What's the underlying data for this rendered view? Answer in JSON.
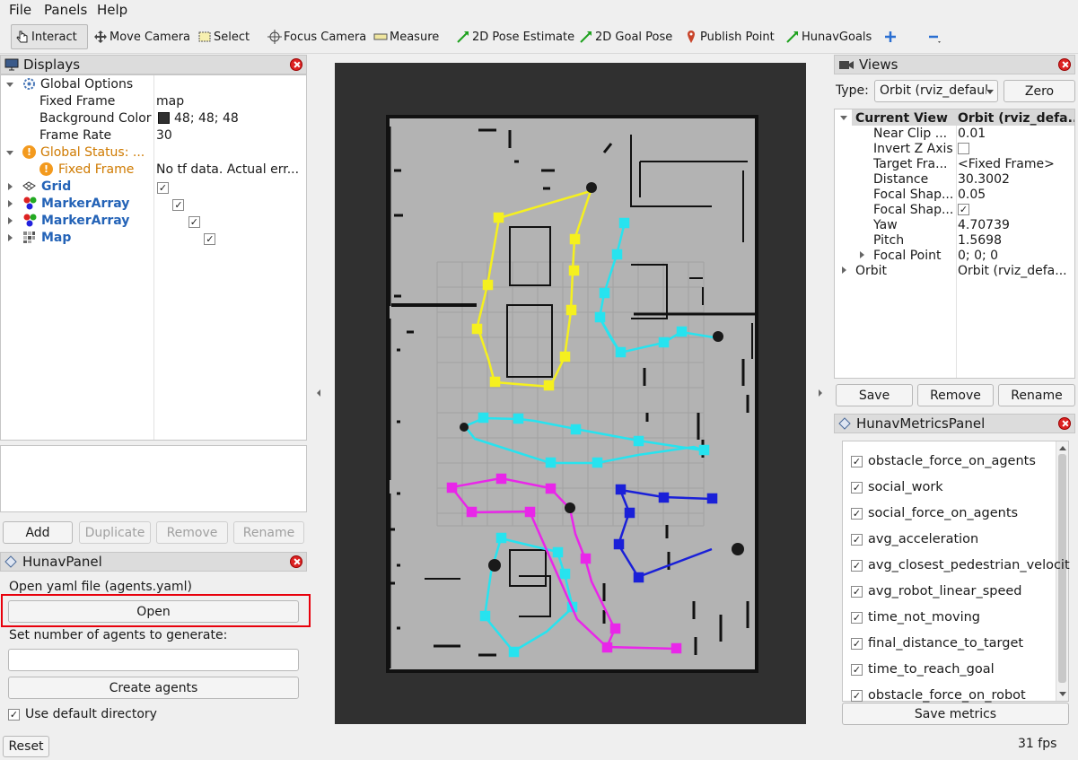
{
  "menu": {
    "file": "File",
    "panels": "Panels",
    "help": "Help"
  },
  "toolbar": {
    "interact": "Interact",
    "move_camera": "Move Camera",
    "select": "Select",
    "focus_camera": "Focus Camera",
    "measure": "Measure",
    "pose_estimate": "2D Pose Estimate",
    "goal_pose": "2D Goal Pose",
    "publish_point": "Publish Point",
    "hunav_goals": "HunavGoals",
    "add_icon": "plus-icon",
    "remove_icon": "minus-icon"
  },
  "displays": {
    "title": "Displays",
    "global_options": "Global Options",
    "fixed_frame_label": "Fixed Frame",
    "fixed_frame_value": "map",
    "bg_color_label": "Background Color",
    "bg_color_value": "48; 48; 48",
    "bg_color_swatch": "#303030",
    "frame_rate_label": "Frame Rate",
    "frame_rate_value": "30",
    "global_status": "Global Status: ...",
    "status_fixed_frame": "Fixed Frame",
    "status_message": "No tf data.  Actual err...",
    "items": [
      {
        "label": "Grid",
        "checked": true
      },
      {
        "label": "MarkerArray",
        "checked": true
      },
      {
        "label": "MarkerArray",
        "checked": true
      },
      {
        "label": "Map",
        "checked": true
      }
    ],
    "buttons": {
      "add": "Add",
      "duplicate": "Duplicate",
      "remove": "Remove",
      "rename": "Rename"
    }
  },
  "hunav_panel": {
    "title": "HunavPanel",
    "open_label": "Open yaml file (agents.yaml)",
    "open_button": "Open",
    "agents_label": "Set number of agents to generate:",
    "agents_value": "",
    "create_button": "Create agents",
    "default_dir_label": "Use default directory",
    "default_dir_checked": true
  },
  "reset_button": "Reset",
  "fps": "31 fps",
  "views": {
    "title": "Views",
    "type_label": "Type:",
    "type_value": "Orbit (rviz_defaul",
    "zero_button": "Zero",
    "header_name": "Current View",
    "header_value": "Orbit (rviz_defa...",
    "props": [
      {
        "label": "Near Clip ...",
        "value": "0.01"
      },
      {
        "label": "Invert Z Axis",
        "value": ""
      },
      {
        "label": "Target Fra...",
        "value": "<Fixed Frame>"
      },
      {
        "label": "Distance",
        "value": "30.3002"
      },
      {
        "label": "Focal Shap...",
        "value": "0.05"
      },
      {
        "label": "Focal Shap...",
        "value": "✓"
      },
      {
        "label": "Yaw",
        "value": "4.70739"
      },
      {
        "label": "Pitch",
        "value": "1.5698"
      },
      {
        "label": "Focal Point",
        "value": "0; 0; 0"
      }
    ],
    "orbit_label": "Orbit",
    "orbit_value": "Orbit (rviz_defa...",
    "buttons": {
      "save": "Save",
      "remove": "Remove",
      "rename": "Rename"
    }
  },
  "metrics_panel": {
    "title": "HunavMetricsPanel",
    "metrics": [
      "obstacle_force_on_agents",
      "social_work",
      "social_force_on_agents",
      "avg_acceleration",
      "avg_closest_pedestrian_velocit",
      "avg_robot_linear_speed",
      "time_not_moving",
      "final_distance_to_target",
      "time_to_reach_goal",
      "obstacle_force_on_robot"
    ],
    "save_button": "Save metrics"
  },
  "colors": {
    "yellow": "#f5f01f",
    "cyan": "#27e3ef",
    "magenta": "#e926e9",
    "blue": "#1a20d8",
    "highlight": "#e8000b"
  }
}
